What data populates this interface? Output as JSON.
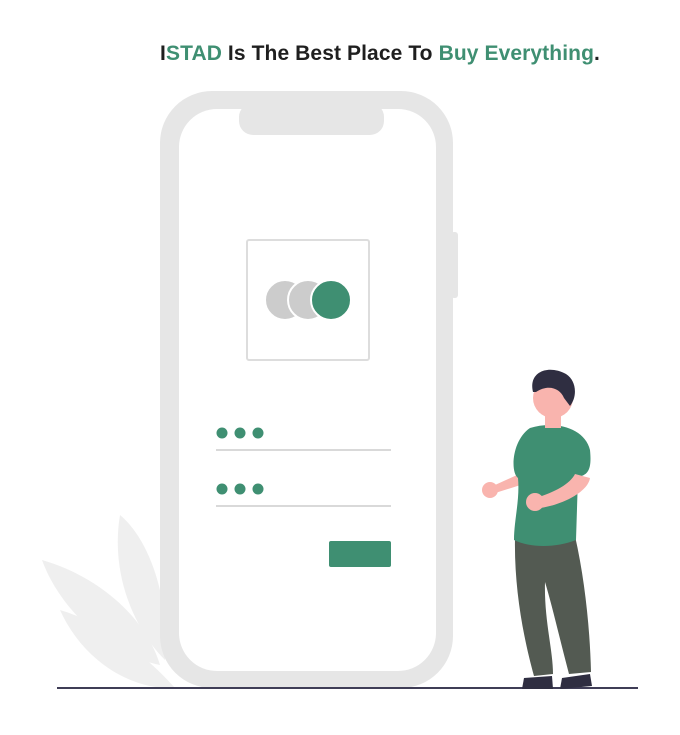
{
  "headline": {
    "part1": "I",
    "part2": "STAD",
    "part3": " Is The Best Place To ",
    "part4": "Buy Everything",
    "part5": "."
  },
  "colors": {
    "accent": "#3f8f72",
    "phone_frame": "#e6e6e6",
    "dark_text": "#1f1f1f",
    "ground": "#3f3d56",
    "skin": "#f9b4ae",
    "pants": "#535a52",
    "hair": "#2f2e41"
  },
  "icons": [
    "leaf-plant-icon",
    "phone-icon",
    "overlapping-circles-logo-icon",
    "password-dots-icon",
    "person-icon"
  ]
}
